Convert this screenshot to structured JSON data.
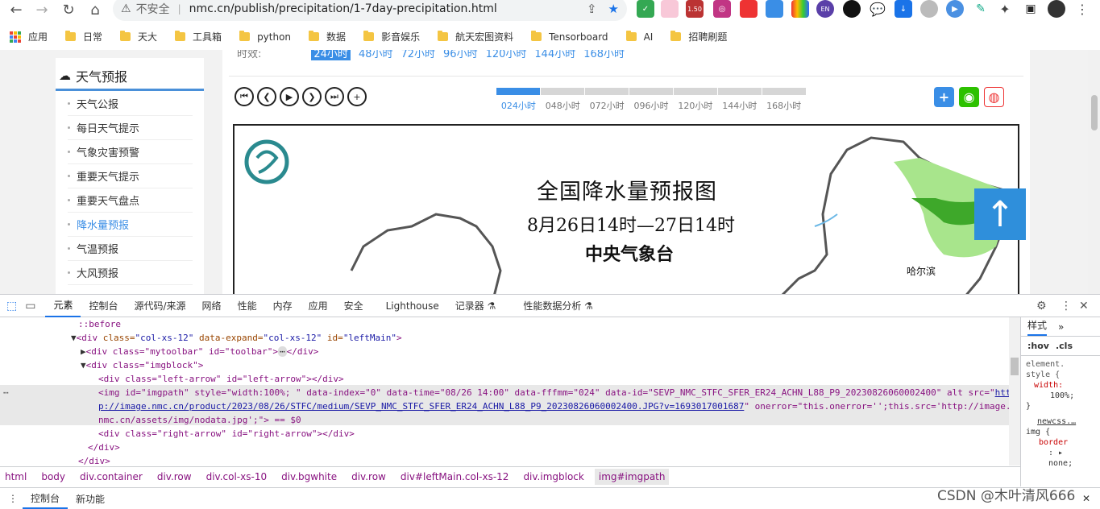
{
  "browser": {
    "insecure_label": "不安全",
    "url": "nmc.cn/publish/precipitation/1-7day-precipitation.html",
    "ext_badge": "1.50",
    "ext_en": "EN"
  },
  "bookmarks": [
    "应用",
    "日常",
    "天大",
    "工具箱",
    "python",
    "数据",
    "影音娱乐",
    "航天宏图资料",
    "Tensorboard",
    "AI",
    "招聘刷题"
  ],
  "sidebar": {
    "title": "天气预报",
    "items": [
      "天气公报",
      "每日天气提示",
      "气象灾害预警",
      "重要天气提示",
      "重要天气盘点",
      "降水量预报",
      "气温预报",
      "大风预报"
    ]
  },
  "timesel": {
    "label": "时效:",
    "options": [
      "24小时",
      "48小时",
      "72小时",
      "96小时",
      "120小时",
      "144小时",
      "168小时"
    ]
  },
  "timeline": [
    "024小时",
    "048小时",
    "072小时",
    "096小时",
    "120小时",
    "144小时",
    "168小时"
  ],
  "map": {
    "title": "全国降水量预报图",
    "subtitle": "8月26日14时—27日14时",
    "org": "中央气象台",
    "city": "哈尔滨"
  },
  "devtools": {
    "tabs": [
      "元素",
      "控制台",
      "源代码/来源",
      "网络",
      "性能",
      "内存",
      "应用",
      "安全",
      "Lighthouse",
      "记录器 ⚗",
      "性能数据分析 ⚗"
    ],
    "lines": {
      "l0": "::before",
      "l1a": "<div ",
      "l1b": "class=",
      "l1c": "\"col-xs-12\"",
      "l1d": " data-expand=",
      "l1e": "\"col-xs-12\"",
      "l1f": " id=",
      "l1g": "\"leftMain\"",
      "l1h": ">",
      "l2": "<div class=\"mytoolbar\" id=\"toolbar\">",
      "l2b": "</div>",
      "l3": "<div class=\"imgblock\">",
      "l4": "<div class=\"left-arrow\" id=\"left-arrow\"></div>",
      "l5a": "<img id=\"imgpath\" style=\"width:100%; \" data-index=\"0\" data-time=\"08/26 14:00\" data-fffmm=\"024\" data-id=\"SEVP_NMC_STFC_SFER_ER24_ACHN_L88_P9_20230826060002400\" alt src=\"",
      "l5b": "htt",
      "l6a": "p://image.nmc.cn/product/2023/08/26/STFC/medium/SEVP_NMC_STFC_SFER_ER24_ACHN_L88_P9_20230826060002400.JPG?v=1693017001687",
      "l6b": "\" onerror=\"this.onerror='';this.src='http://image.",
      "l7": "nmc.cn/assets/img/nodata.jpg';\"> == $0",
      "l8": "<div class=\"right-arrow\" id=\"right-arrow\"></div>",
      "l9": "</div>",
      "l10": "</div>"
    },
    "crumbs": [
      "html",
      "body",
      "div.container",
      "div.row",
      "div.col-xs-10",
      "div.bgwhite",
      "div.row",
      "div#leftMain.col-xs-12",
      "div.imgblock",
      "img#imgpath"
    ],
    "drawer_tabs": [
      "控制台",
      "新功能"
    ],
    "styles": {
      "tab": "样式",
      "filter_hov": ":hov",
      "filter_cls": ".cls",
      "l1": "element.",
      "l2": "style {",
      "l3": "width:",
      "l4": "100%;",
      "l5": "}",
      "l6": "newcss.…",
      "l7": "img {",
      "l8": "border",
      "l9": ": ▸",
      "l10": "none;"
    }
  },
  "watermark": "CSDN @木叶清风666"
}
